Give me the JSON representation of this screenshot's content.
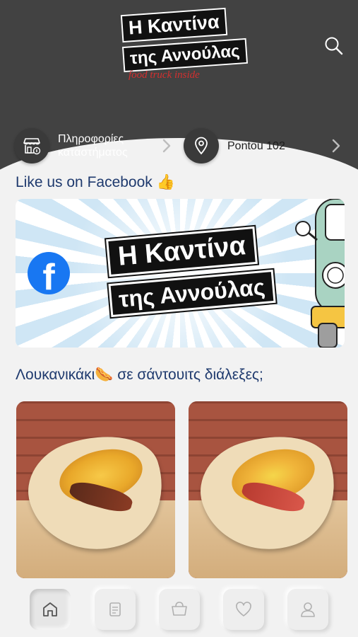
{
  "brand": {
    "line1": "Η Καντίνα",
    "line2": "της Αννούλας",
    "tagline": "food truck inside"
  },
  "header": {
    "search_icon": "search-icon"
  },
  "info": {
    "store_label": "Πληροφορίες καταστήματος",
    "address_label": "Pontou 102"
  },
  "facebook": {
    "title": "Like us on Facebook 👍",
    "banner_logo_line1": "Η Καντίνα",
    "banner_logo_line2": "της Αννούλας",
    "fb_glyph": "f"
  },
  "products": {
    "section_title": "Λουκανικάκι🌭 σε σάντουιτς διάλεξες;"
  },
  "bottom_nav": {
    "items": [
      "home-icon",
      "menu-icon",
      "cart-icon",
      "favorites-icon",
      "profile-icon"
    ],
    "active_index": 0
  },
  "colors": {
    "header_bg": "#424242",
    "page_bg": "#f2f2f2",
    "title_blue": "#1f3a6e",
    "facebook_blue": "#1877f2",
    "tagline_red": "#d32f2f"
  }
}
